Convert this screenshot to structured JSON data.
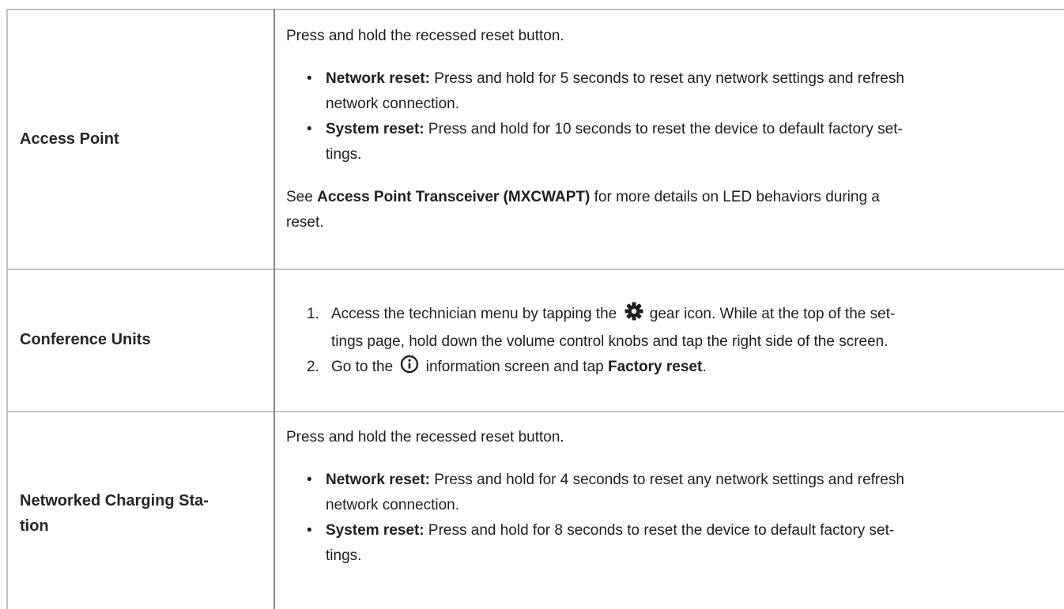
{
  "rows": [
    {
      "label": "Access Point",
      "intro": "Press and hold the recessed reset button.",
      "bullets": [
        {
          "lead": "Network reset:",
          "line1": "Press and hold for 5 seconds to reset any network settings and refresh",
          "line2": "network connection."
        },
        {
          "lead": "System reset:",
          "line1": "Press and hold for 10 seconds to reset the device to default factory set-",
          "line2": "tings."
        }
      ],
      "see_prefix": "See",
      "see_link": "Access Point Transceiver (MXCWAPT)",
      "see_suffix_line1": "for more details on LED behaviors during a",
      "see_suffix_line2": "reset."
    },
    {
      "label": "Conference Units",
      "steps": [
        {
          "num": "1.",
          "before_icon": "Access the technician menu by tapping the",
          "icon": "gear-icon",
          "after_icon": "gear icon. While at the top of the set-",
          "line2": "tings page, hold down the volume control knobs and tap the right side of the screen."
        },
        {
          "num": "2.",
          "before_icon": "Go to the",
          "icon": "info-icon",
          "after_icon": "information screen and tap",
          "bold": "Factory reset",
          "end": "."
        }
      ]
    },
    {
      "label_line1": "Networked Charging Sta-",
      "label_line2": "tion",
      "intro": "Press and hold the recessed reset button.",
      "bullets": [
        {
          "lead": "Network reset:",
          "line1": "Press and hold for 4 seconds to reset any network settings and refresh",
          "line2": "network connection."
        },
        {
          "lead": "System reset:",
          "line1": "Press and hold for 8 seconds to reset the device to default factory set-",
          "line2": "tings."
        }
      ]
    }
  ],
  "bullet_char": "•"
}
